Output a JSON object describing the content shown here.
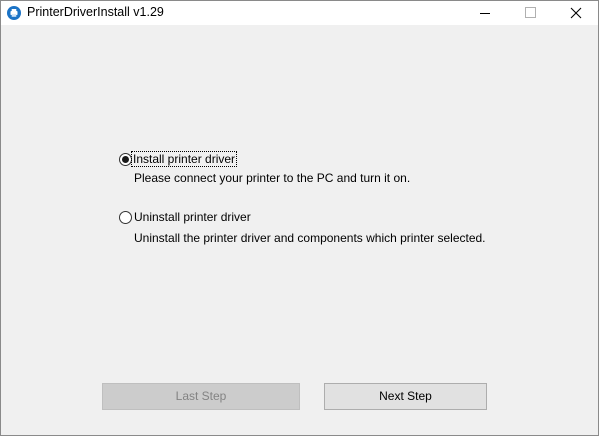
{
  "window": {
    "title": "PrinterDriverInstall v1.29",
    "app_icon": "printer-app-icon"
  },
  "title_controls": {
    "minimize_icon": "minimize-icon",
    "maximize_icon": "maximize-icon",
    "close_icon": "close-icon"
  },
  "options": [
    {
      "label": "Install printer driver",
      "description": "Please connect your printer to the PC and turn it on.",
      "selected": true
    },
    {
      "label": "Uninstall printer driver",
      "description": "Uninstall the printer driver and components which printer selected.",
      "selected": false
    }
  ],
  "buttons": {
    "last_step": "Last Step",
    "last_step_enabled": false,
    "next_step": "Next Step",
    "next_step_enabled": true
  },
  "colors": {
    "window_bg": "#f0f0f0",
    "titlebar_bg": "#ffffff",
    "app_icon_blue": "#1b73c6",
    "disabled_text": "#838383"
  }
}
